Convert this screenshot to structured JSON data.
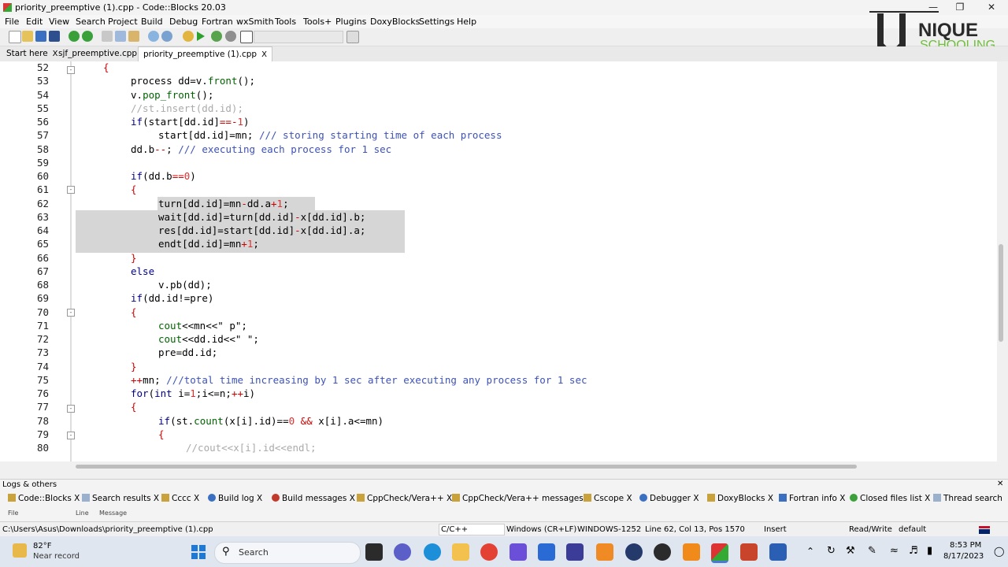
{
  "window": {
    "title": "priority_preemptive (1).cpp - Code::Blocks 20.03"
  },
  "menu": [
    "File",
    "Edit",
    "View",
    "Search",
    "Project",
    "Build",
    "Debug",
    "Fortran",
    "wxSmith",
    "Tools",
    "Tools+",
    "Plugins",
    "DoxyBlocks",
    "Settings",
    "Help"
  ],
  "tabs": [
    {
      "label": "Start here",
      "close": "X"
    },
    {
      "label": "sjf_preemptive.cpp",
      "close": "X"
    },
    {
      "label": "priority_preemptive (1).cpp",
      "close": "X"
    }
  ],
  "watermark": {
    "text1": "NIQUE",
    "text2": "SCHOOLING"
  },
  "lines": [
    "52",
    "53",
    "54",
    "55",
    "56",
    "57",
    "58",
    "59",
    "60",
    "61",
    "62",
    "63",
    "64",
    "65",
    "66",
    "67",
    "68",
    "69",
    "70",
    "71",
    "72",
    "73",
    "74",
    "75",
    "76",
    "77",
    "78",
    "79",
    "80"
  ],
  "logs": {
    "title": "Logs & others",
    "tabs": [
      "Code::Blocks",
      "Search results",
      "Cccc",
      "Build log",
      "Build messages",
      "CppCheck/Vera++",
      "CppCheck/Vera++ messages",
      "Cscope",
      "Debugger",
      "DoxyBlocks",
      "Fortran info",
      "Closed files list",
      "Thread search"
    ],
    "columns": [
      "File",
      "Line",
      "Message"
    ]
  },
  "status": {
    "path": "C:\\Users\\Asus\\Downloads\\priority_preemptive (1).cpp",
    "lang": "C/C++",
    "eol": "Windows (CR+LF)",
    "enc": "WINDOWS-1252",
    "pos": "Line 62, Col 13, Pos 1570",
    "mode": "Insert",
    "rw": "Read/Write",
    "profile": "default"
  },
  "taskbar": {
    "temp": "82°F",
    "weather": "Near record",
    "search": "Search",
    "time": "8:53 PM",
    "date": "8/17/2023"
  },
  "colors": {
    "keyword": "#00008b",
    "comment": "#aaaaaa",
    "doc_comment": "#3d52b8",
    "number": "#e03030",
    "selection": "#d6d6d6"
  }
}
